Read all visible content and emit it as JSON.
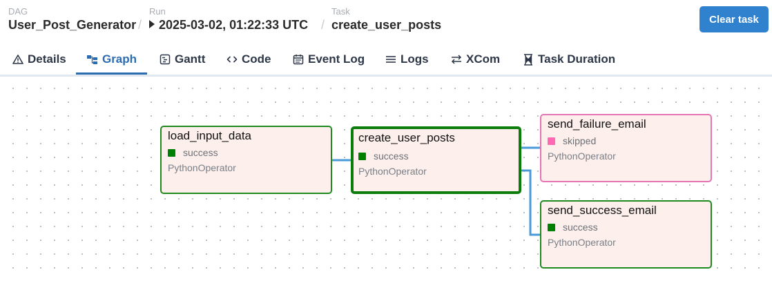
{
  "header": {
    "dag_label": "DAG",
    "dag_value": "User_Post_Generator",
    "run_label": "Run",
    "run_value": "2025-03-02, 01:22:33 UTC",
    "task_label": "Task",
    "task_value": "create_user_posts",
    "separator": "/",
    "clear_button": "Clear task"
  },
  "tabs": [
    {
      "label": "Details",
      "icon": "warning-triangle-icon"
    },
    {
      "label": "Graph",
      "icon": "graph-icon",
      "active": true
    },
    {
      "label": "Gantt",
      "icon": "gantt-icon"
    },
    {
      "label": "Code",
      "icon": "code-icon"
    },
    {
      "label": "Event Log",
      "icon": "calendar-icon"
    },
    {
      "label": "Logs",
      "icon": "list-icon"
    },
    {
      "label": "XCom",
      "icon": "swap-arrows-icon"
    },
    {
      "label": "Task Duration",
      "icon": "hourglass-icon"
    }
  ],
  "colors": {
    "success": "#008000",
    "skipped": "#ff69b4",
    "edge": "#4a9ad8",
    "accent": "#2b6cb0"
  },
  "nodes": [
    {
      "name": "load_input_data",
      "state": "success",
      "operator": "PythonOperator"
    },
    {
      "name": "create_user_posts",
      "state": "success",
      "operator": "PythonOperator",
      "selected": true
    },
    {
      "name": "send_failure_email",
      "state": "skipped",
      "operator": "PythonOperator"
    },
    {
      "name": "send_success_email",
      "state": "success",
      "operator": "PythonOperator"
    }
  ]
}
